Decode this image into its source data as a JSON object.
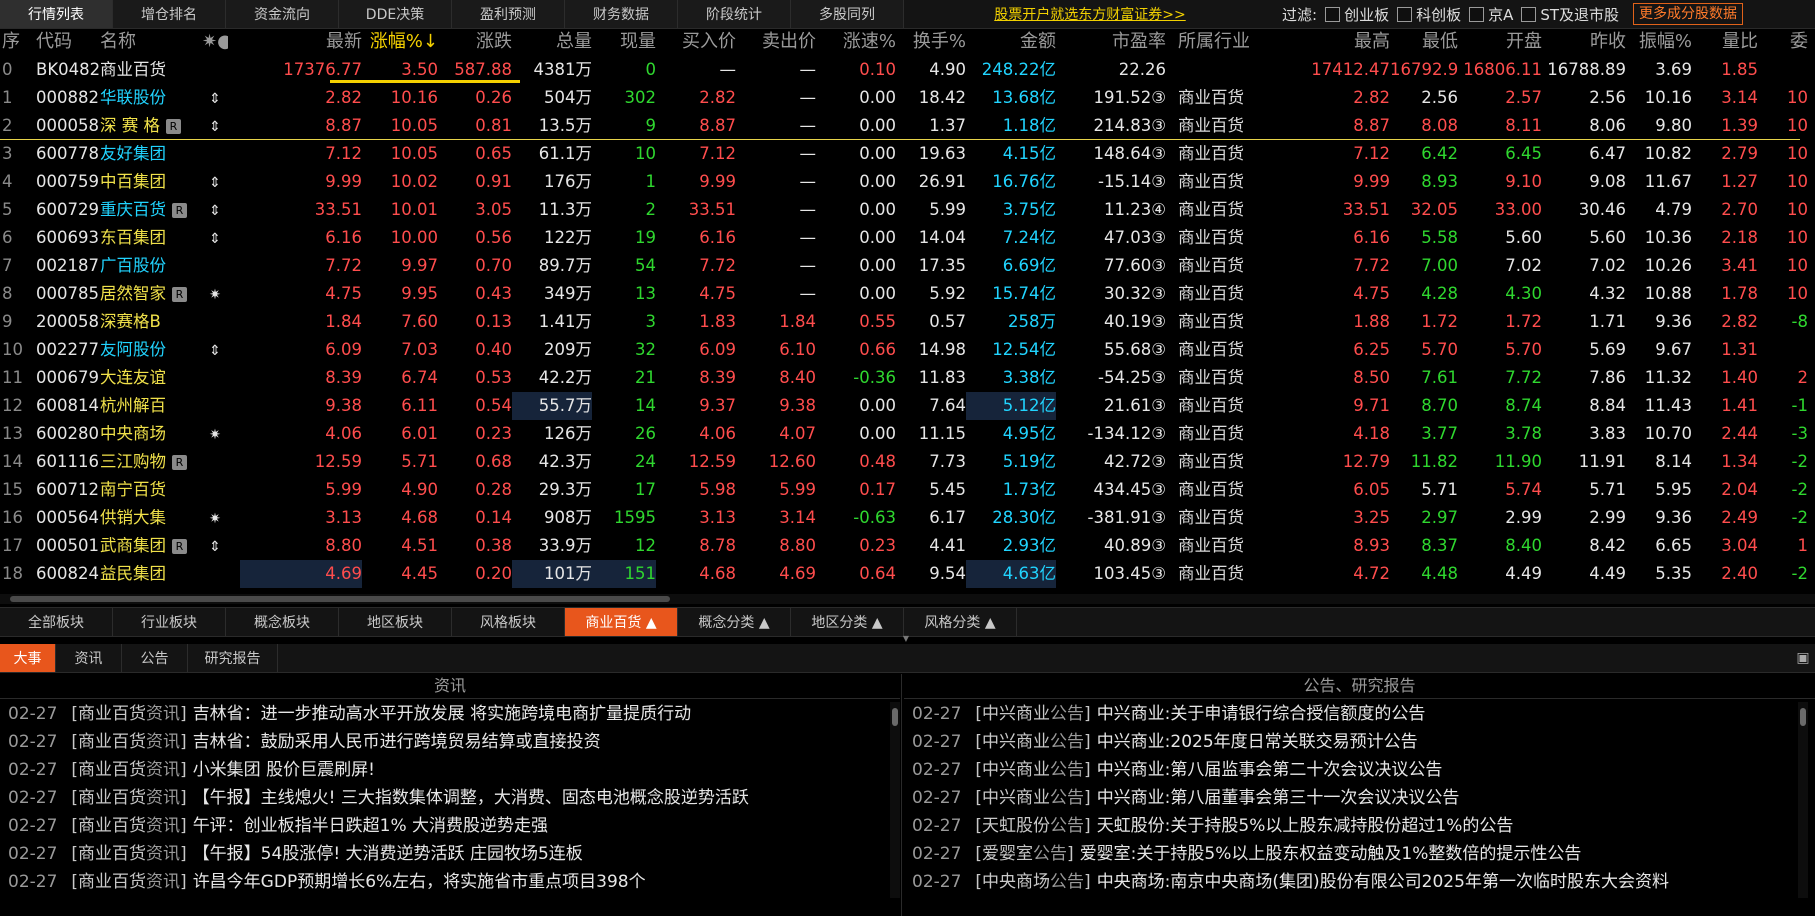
{
  "top_tabs": [
    "行情列表",
    "增仓排名",
    "资金流向",
    "DDE决策",
    "盈利预测",
    "财务数据",
    "阶段统计",
    "多股同列"
  ],
  "promo": "股票开户就选东方财富证券>>",
  "filter_label": "过滤:",
  "filters": [
    "创业板",
    "科创板",
    "京A",
    "ST及退市股"
  ],
  "more_btn": "更多成分股数据",
  "headers": [
    "序",
    "代码",
    "名称",
    "✷●",
    "最新",
    "涨幅%↓",
    "涨跌",
    "总量",
    "现量",
    "买入价",
    "卖出价",
    "涨速%",
    "换手%",
    "金额",
    "市盈率",
    "所属行业",
    "最高",
    "最低",
    "开盘",
    "昨收",
    "振幅%",
    "量比",
    "委"
  ],
  "rows": [
    {
      "i": "0",
      "code": "BK0482",
      "name": "商业百货",
      "flag": "",
      "last": "17376.77",
      "pct": "3.50",
      "chg": "587.88",
      "vol": "4381万",
      "cur": "0",
      "bid": "—",
      "ask": "—",
      "spd": "0.10",
      "turn": "4.90",
      "amt": "248.22亿",
      "pe": "22.26",
      "ind": "",
      "high": "17412.47",
      "low": "16792.90",
      "open": "16806.11",
      "prev": "16788.89",
      "amp": "3.69",
      "vr": "1.85",
      "wb": ""
    },
    {
      "i": "1",
      "code": "000882",
      "name": "华联股份",
      "flag": "⇕",
      "last": "2.82",
      "pct": "10.16",
      "chg": "0.26",
      "vol": "504万",
      "cur": "302",
      "bid": "2.82",
      "ask": "—",
      "spd": "0.00",
      "turn": "18.42",
      "amt": "13.68亿",
      "pe": "191.52③",
      "ind": "商业百货",
      "high": "2.82",
      "low": "2.56",
      "open": "2.57",
      "prev": "2.56",
      "amp": "10.16",
      "vr": "3.14",
      "wb": "10"
    },
    {
      "i": "2",
      "code": "000058",
      "name": "深 赛 格",
      "flag": "⇕",
      "last": "8.87",
      "pct": "10.05",
      "chg": "0.81",
      "vol": "13.5万",
      "cur": "9",
      "bid": "8.87",
      "ask": "—",
      "spd": "0.00",
      "turn": "1.37",
      "amt": "1.18亿",
      "pe": "214.83③",
      "ind": "商业百货",
      "high": "8.87",
      "low": "8.08",
      "open": "8.11",
      "prev": "8.06",
      "amp": "9.80",
      "vr": "1.39",
      "wb": "10"
    },
    {
      "i": "3",
      "code": "600778",
      "name": "友好集团",
      "flag": "",
      "last": "7.12",
      "pct": "10.05",
      "chg": "0.65",
      "vol": "61.1万",
      "cur": "10",
      "bid": "7.12",
      "ask": "—",
      "spd": "0.00",
      "turn": "19.63",
      "amt": "4.15亿",
      "pe": "148.64③",
      "ind": "商业百货",
      "high": "7.12",
      "low": "6.42",
      "open": "6.45",
      "prev": "6.47",
      "amp": "10.82",
      "vr": "2.79",
      "wb": "10"
    },
    {
      "i": "4",
      "code": "000759",
      "name": "中百集团",
      "flag": "⇕",
      "last": "9.99",
      "pct": "10.02",
      "chg": "0.91",
      "vol": "176万",
      "cur": "1",
      "bid": "9.99",
      "ask": "—",
      "spd": "0.00",
      "turn": "26.91",
      "amt": "16.76亿",
      "pe": "-15.14③",
      "ind": "商业百货",
      "high": "9.99",
      "low": "8.93",
      "open": "9.10",
      "prev": "9.08",
      "amp": "11.67",
      "vr": "1.27",
      "wb": "10"
    },
    {
      "i": "5",
      "code": "600729",
      "name": "重庆百货",
      "flag": "⇕",
      "last": "33.51",
      "pct": "10.01",
      "chg": "3.05",
      "vol": "11.3万",
      "cur": "2",
      "bid": "33.51",
      "ask": "—",
      "spd": "0.00",
      "turn": "5.99",
      "amt": "3.75亿",
      "pe": "11.23④",
      "ind": "商业百货",
      "high": "33.51",
      "low": "32.05",
      "open": "33.00",
      "prev": "30.46",
      "amp": "4.79",
      "vr": "2.70",
      "wb": "10"
    },
    {
      "i": "6",
      "code": "600693",
      "name": "东百集团",
      "flag": "⇕",
      "last": "6.16",
      "pct": "10.00",
      "chg": "0.56",
      "vol": "122万",
      "cur": "19",
      "bid": "6.16",
      "ask": "—",
      "spd": "0.00",
      "turn": "14.04",
      "amt": "7.24亿",
      "pe": "47.03③",
      "ind": "商业百货",
      "high": "6.16",
      "low": "5.58",
      "open": "5.60",
      "prev": "5.60",
      "amp": "10.36",
      "vr": "2.18",
      "wb": "10"
    },
    {
      "i": "7",
      "code": "002187",
      "name": "广百股份",
      "flag": "",
      "last": "7.72",
      "pct": "9.97",
      "chg": "0.70",
      "vol": "89.7万",
      "cur": "54",
      "bid": "7.72",
      "ask": "—",
      "spd": "0.00",
      "turn": "17.35",
      "amt": "6.69亿",
      "pe": "77.60③",
      "ind": "商业百货",
      "high": "7.72",
      "low": "7.00",
      "open": "7.02",
      "prev": "7.02",
      "amp": "10.26",
      "vr": "3.41",
      "wb": "10"
    },
    {
      "i": "8",
      "code": "000785",
      "name": "居然智家",
      "flag": "✷",
      "last": "4.75",
      "pct": "9.95",
      "chg": "0.43",
      "vol": "349万",
      "cur": "13",
      "bid": "4.75",
      "ask": "—",
      "spd": "0.00",
      "turn": "5.92",
      "amt": "15.74亿",
      "pe": "30.32③",
      "ind": "商业百货",
      "high": "4.75",
      "low": "4.28",
      "open": "4.30",
      "prev": "4.32",
      "amp": "10.88",
      "vr": "1.78",
      "wb": "10"
    },
    {
      "i": "9",
      "code": "200058",
      "name": "深赛格B",
      "flag": "",
      "last": "1.84",
      "pct": "7.60",
      "chg": "0.13",
      "vol": "1.41万",
      "cur": "3",
      "bid": "1.83",
      "ask": "1.84",
      "spd": "0.55",
      "turn": "0.57",
      "amt": "258万",
      "pe": "40.19③",
      "ind": "商业百货",
      "high": "1.88",
      "low": "1.72",
      "open": "1.72",
      "prev": "1.71",
      "amp": "9.36",
      "vr": "2.82",
      "wb": "-8"
    },
    {
      "i": "10",
      "code": "002277",
      "name": "友阿股份",
      "flag": "⇕",
      "last": "6.09",
      "pct": "7.03",
      "chg": "0.40",
      "vol": "209万",
      "cur": "32",
      "bid": "6.09",
      "ask": "6.10",
      "spd": "0.66",
      "turn": "14.98",
      "amt": "12.54亿",
      "pe": "55.68③",
      "ind": "商业百货",
      "high": "6.25",
      "low": "5.70",
      "open": "5.70",
      "prev": "5.69",
      "amp": "9.67",
      "vr": "1.31",
      "wb": ""
    },
    {
      "i": "11",
      "code": "000679",
      "name": "大连友谊",
      "flag": "",
      "last": "8.39",
      "pct": "6.74",
      "chg": "0.53",
      "vol": "42.2万",
      "cur": "21",
      "bid": "8.39",
      "ask": "8.40",
      "spd": "-0.36",
      "turn": "11.83",
      "amt": "3.38亿",
      "pe": "-54.25③",
      "ind": "商业百货",
      "high": "8.50",
      "low": "7.61",
      "open": "7.72",
      "prev": "7.86",
      "amp": "11.32",
      "vr": "1.40",
      "wb": "2"
    },
    {
      "i": "12",
      "code": "600814",
      "name": "杭州解百",
      "flag": "",
      "last": "9.38",
      "pct": "6.11",
      "chg": "0.54",
      "vol": "55.7万",
      "cur": "14",
      "bid": "9.37",
      "ask": "9.38",
      "spd": "0.00",
      "turn": "7.64",
      "amt": "5.12亿",
      "pe": "21.61③",
      "ind": "商业百货",
      "high": "9.71",
      "low": "8.70",
      "open": "8.74",
      "prev": "8.84",
      "amp": "11.43",
      "vr": "1.41",
      "wb": "-1"
    },
    {
      "i": "13",
      "code": "600280",
      "name": "中央商场",
      "flag": "✷",
      "last": "4.06",
      "pct": "6.01",
      "chg": "0.23",
      "vol": "126万",
      "cur": "26",
      "bid": "4.06",
      "ask": "4.07",
      "spd": "0.00",
      "turn": "11.15",
      "amt": "4.95亿",
      "pe": "-134.12③",
      "ind": "商业百货",
      "high": "4.18",
      "low": "3.77",
      "open": "3.78",
      "prev": "3.83",
      "amp": "10.70",
      "vr": "2.44",
      "wb": "-3"
    },
    {
      "i": "14",
      "code": "601116",
      "name": "三江购物",
      "flag": "",
      "last": "12.59",
      "pct": "5.71",
      "chg": "0.68",
      "vol": "42.3万",
      "cur": "24",
      "bid": "12.59",
      "ask": "12.60",
      "spd": "0.48",
      "turn": "7.73",
      "amt": "5.19亿",
      "pe": "42.72③",
      "ind": "商业百货",
      "high": "12.79",
      "low": "11.82",
      "open": "11.90",
      "prev": "11.91",
      "amp": "8.14",
      "vr": "1.34",
      "wb": "-2"
    },
    {
      "i": "15",
      "code": "600712",
      "name": "南宁百货",
      "flag": "",
      "last": "5.99",
      "pct": "4.90",
      "chg": "0.28",
      "vol": "29.3万",
      "cur": "17",
      "bid": "5.98",
      "ask": "5.99",
      "spd": "0.17",
      "turn": "5.45",
      "amt": "1.73亿",
      "pe": "434.45③",
      "ind": "商业百货",
      "high": "6.05",
      "low": "5.71",
      "open": "5.74",
      "prev": "5.71",
      "amp": "5.95",
      "vr": "2.04",
      "wb": "-2"
    },
    {
      "i": "16",
      "code": "000564",
      "name": "供销大集",
      "flag": "✷",
      "last": "3.13",
      "pct": "4.68",
      "chg": "0.14",
      "vol": "908万",
      "cur": "1595",
      "bid": "3.13",
      "ask": "3.14",
      "spd": "-0.63",
      "turn": "6.17",
      "amt": "28.30亿",
      "pe": "-381.91③",
      "ind": "商业百货",
      "high": "3.25",
      "low": "2.97",
      "open": "2.99",
      "prev": "2.99",
      "amp": "9.36",
      "vr": "2.49",
      "wb": "-2"
    },
    {
      "i": "17",
      "code": "000501",
      "name": "武商集团",
      "flag": "⇕",
      "last": "8.80",
      "pct": "4.51",
      "chg": "0.38",
      "vol": "33.9万",
      "cur": "12",
      "bid": "8.78",
      "ask": "8.80",
      "spd": "0.23",
      "turn": "4.41",
      "amt": "2.93亿",
      "pe": "40.89③",
      "ind": "商业百货",
      "high": "8.93",
      "low": "8.37",
      "open": "8.40",
      "prev": "8.42",
      "amp": "6.65",
      "vr": "3.04",
      "wb": "1"
    },
    {
      "i": "18",
      "code": "600824",
      "name": "益民集团",
      "flag": "",
      "last": "4.69",
      "pct": "4.45",
      "chg": "0.20",
      "vol": "101万",
      "cur": "151",
      "bid": "4.68",
      "ask": "4.69",
      "spd": "0.64",
      "turn": "9.54",
      "amt": "4.63亿",
      "pe": "103.45③",
      "ind": "商业百货",
      "high": "4.72",
      "low": "4.48",
      "open": "4.49",
      "prev": "4.49",
      "amp": "5.35",
      "vr": "2.40",
      "wb": "-2"
    }
  ],
  "sector_tabs": [
    "全部板块",
    "行业板块",
    "概念板块",
    "地区板块",
    "风格板块",
    "商业百货 ▲",
    "概念分类 ▲",
    "地区分类 ▲",
    "风格分类 ▲"
  ],
  "news_tabs": [
    "大事",
    "资讯",
    "公告",
    "研究报告"
  ],
  "left_pane_title": "资讯",
  "right_pane_title": "公告、研究报告",
  "left_news": [
    {
      "date": "02-27",
      "src": "商业百货",
      "kind": "资讯",
      "text": "吉林省：进一步推动高水平开放发展 将实施跨境电商扩量提质行动"
    },
    {
      "date": "02-27",
      "src": "商业百货",
      "kind": "资讯",
      "text": "吉林省：鼓励采用人民币进行跨境贸易结算或直接投资"
    },
    {
      "date": "02-27",
      "src": "商业百货",
      "kind": "资讯",
      "text": "小米集团 股价巨震刷屏!"
    },
    {
      "date": "02-27",
      "src": "商业百货",
      "kind": "资讯",
      "text": "【午报】主线熄火! 三大指数集体调整，大消费、固态电池概念股逆势活跃"
    },
    {
      "date": "02-27",
      "src": "商业百货",
      "kind": "资讯",
      "text": "午评：创业板指半日跌超1% 大消费股逆势走强"
    },
    {
      "date": "02-27",
      "src": "商业百货",
      "kind": "资讯",
      "text": "【午报】54股涨停! 大消费逆势活跃 庄园牧场5连板"
    },
    {
      "date": "02-27",
      "src": "商业百货",
      "kind": "资讯",
      "text": "许昌今年GDP预期增长6%左右，将实施省市重点项目398个"
    }
  ],
  "right_news": [
    {
      "date": "02-27",
      "src": "中兴商业",
      "kind": "公告",
      "text": "中兴商业:关于申请银行综合授信额度的公告"
    },
    {
      "date": "02-27",
      "src": "中兴商业",
      "kind": "公告",
      "text": "中兴商业:2025年度日常关联交易预计公告"
    },
    {
      "date": "02-27",
      "src": "中兴商业",
      "kind": "公告",
      "text": "中兴商业:第八届监事会第二十次会议决议公告"
    },
    {
      "date": "02-27",
      "src": "中兴商业",
      "kind": "公告",
      "text": "中兴商业:第八届董事会第三十一次会议决议公告"
    },
    {
      "date": "02-27",
      "src": "天虹股份",
      "kind": "公告",
      "text": "天虹股份:关于持股5%以上股东减持股份超过1%的公告"
    },
    {
      "date": "02-27",
      "src": "爱婴室",
      "kind": "公告",
      "text": "爱婴室:关于持股5%以上股东权益变动触及1%整数倍的提示性公告"
    },
    {
      "date": "02-27",
      "src": "中央商场",
      "kind": "公告",
      "text": "中央商场:南京中央商场(集团)股份有限公司2025年第一次临时股东大会资料"
    }
  ]
}
